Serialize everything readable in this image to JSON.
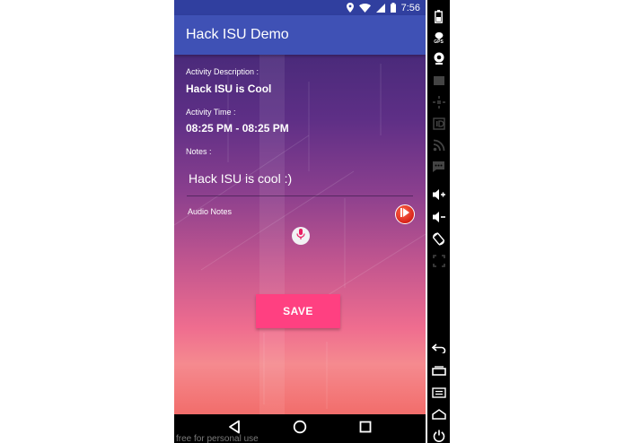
{
  "status_bar": {
    "time": "7:56"
  },
  "app_bar": {
    "title": "Hack ISU Demo"
  },
  "form": {
    "activity_description_label": "Activity Description :",
    "activity_description_value": "Hack ISU is Cool",
    "activity_time_label": "Activity Time :",
    "activity_time_value": "08:25 PM - 08:25 PM",
    "notes_label": "Notes :",
    "notes_value": "Hack ISU is cool :)",
    "audio_notes_label": "Audio Notes",
    "save_label": "SAVE"
  },
  "emulator_sidebar": {
    "gps_label": "GPS"
  },
  "watermark": "free for personal use",
  "colors": {
    "status_bar": "#303f9f",
    "app_bar": "#3f51b5",
    "save_button": "#ff4081",
    "play_button": "#e0301e"
  }
}
